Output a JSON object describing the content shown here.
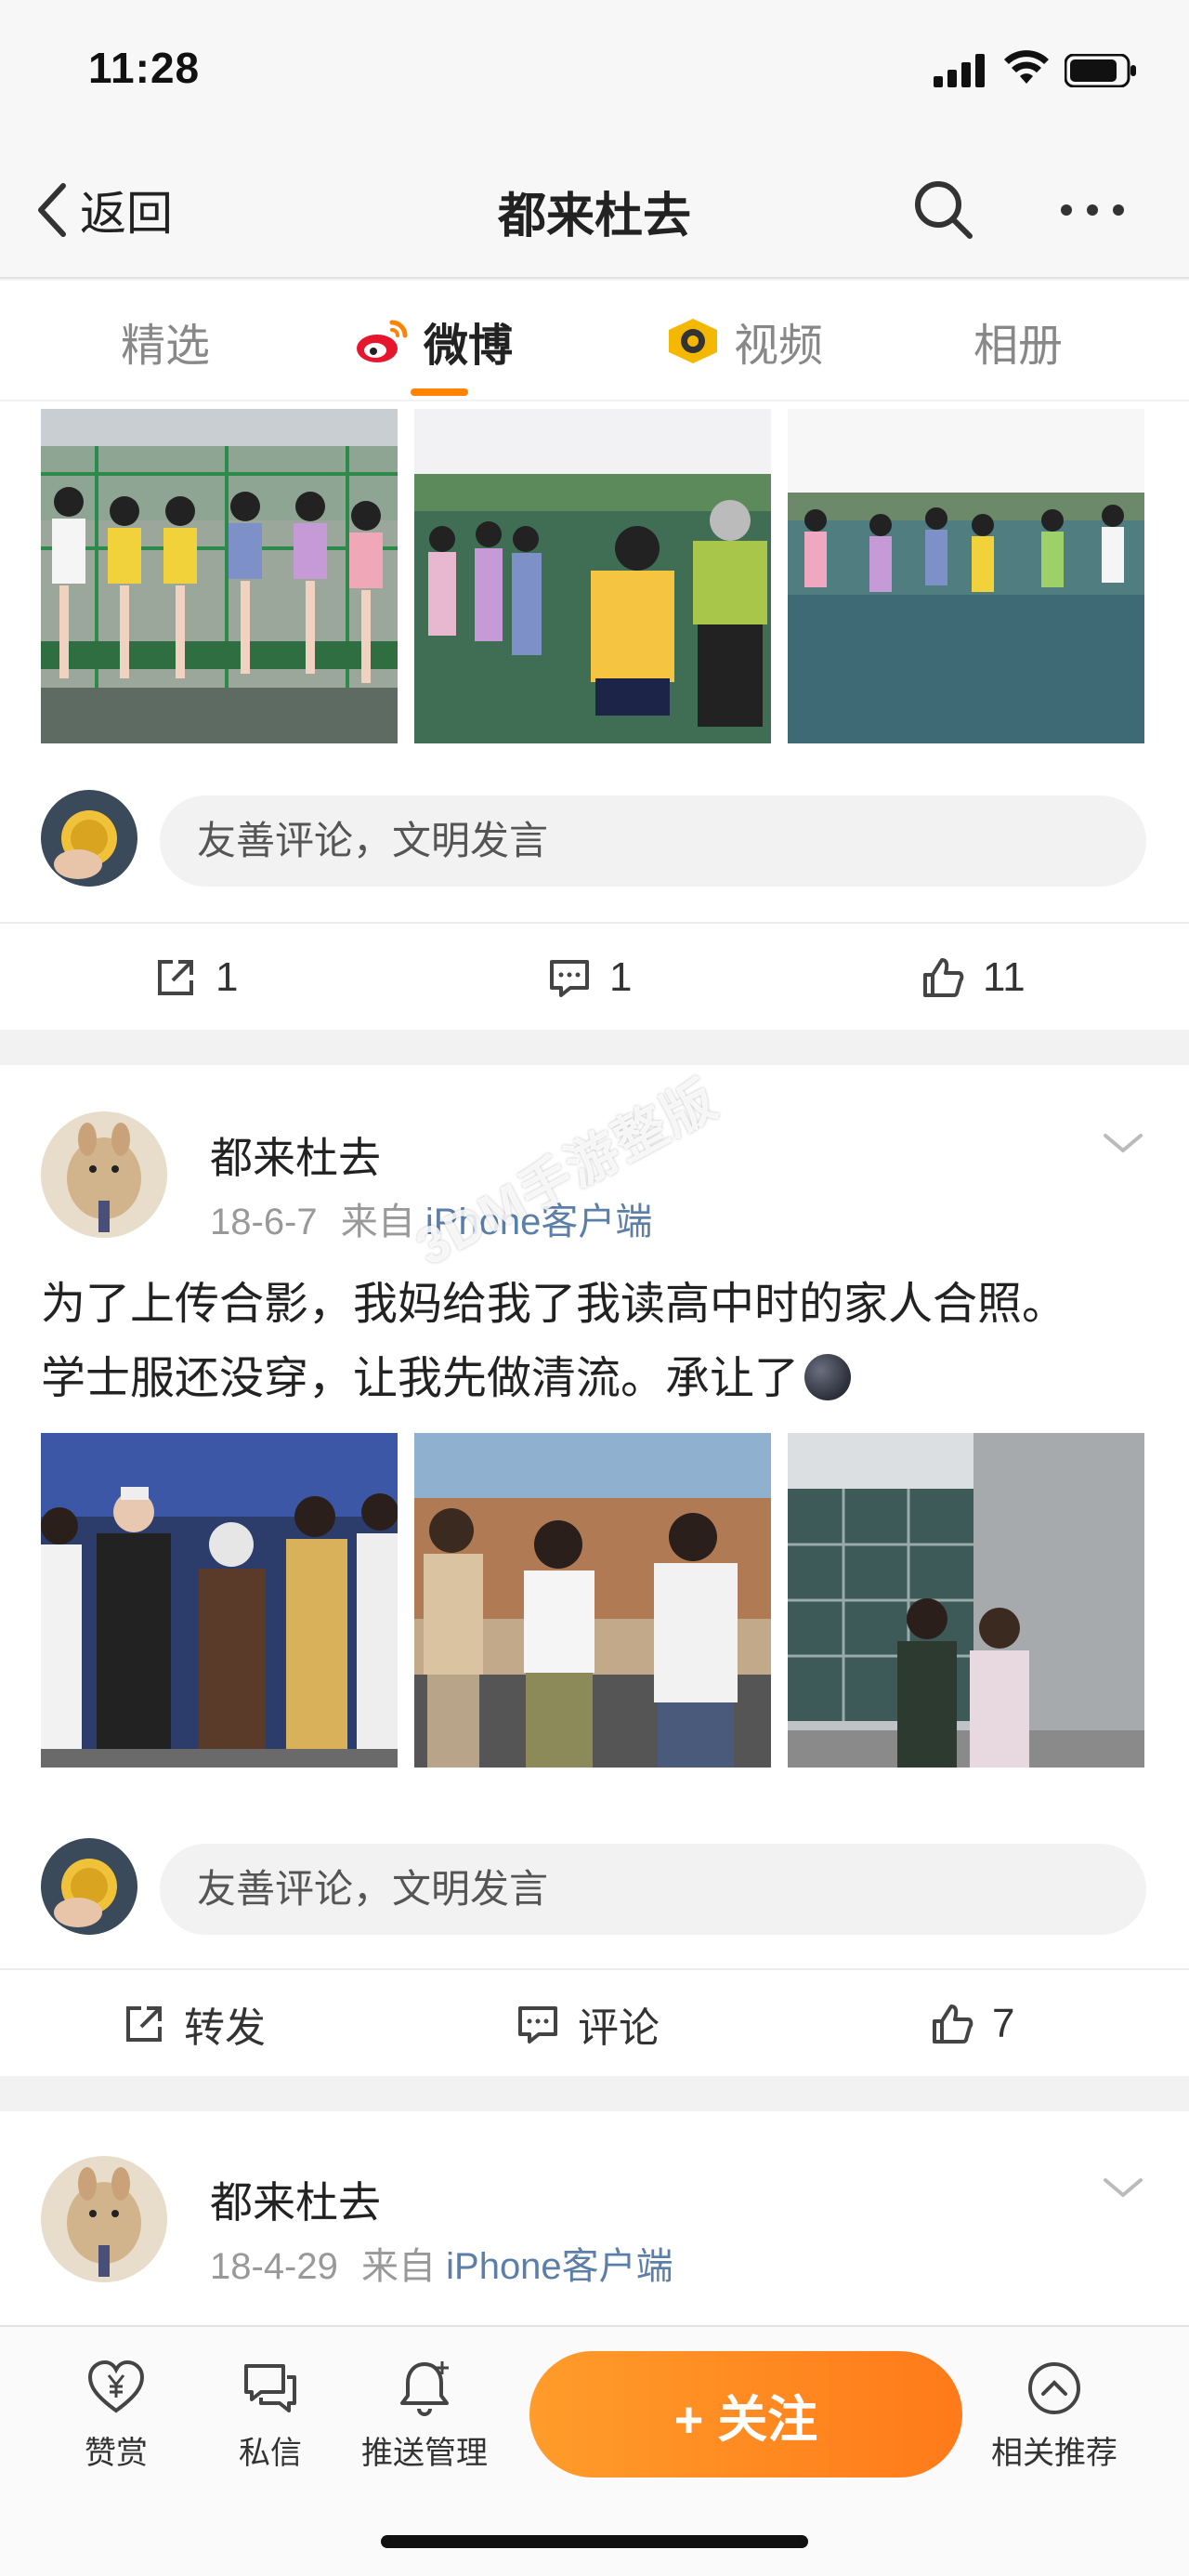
{
  "status_bar": {
    "time": "11:28"
  },
  "nav": {
    "back_label": "返回",
    "title": "都来杜去"
  },
  "tabs": [
    {
      "label": "精选"
    },
    {
      "label": "微博"
    },
    {
      "label": "视频"
    },
    {
      "label": "相册"
    }
  ],
  "post1": {
    "comment_placeholder": "友善评论，文明发言",
    "actions": {
      "repost": "1",
      "comment": "1",
      "like": "11"
    }
  },
  "post2": {
    "author": "都来杜去",
    "date": "18-6-7",
    "source_prefix": "来自",
    "source": "iPhone客户端",
    "text_line1": "为了上传合影，我妈给我了我读高中时的家人合照。",
    "text_line2": "学士服还没穿，让我先做清流。承让了",
    "comment_placeholder": "友善评论，文明发言",
    "actions": {
      "repost": "转发",
      "comment": "评论",
      "like": "7"
    }
  },
  "post3": {
    "author": "都来杜去",
    "date": "18-4-29",
    "source_prefix": "来自",
    "source": "iPhone客户端"
  },
  "watermark": "3DM手游整版",
  "bottom_bar": {
    "reward": "赞赏",
    "message": "私信",
    "push": "推送管理",
    "follow": "+ 关注",
    "related": "相关推荐"
  },
  "colors": {
    "accent": "#ff8200",
    "link": "#5b7fa8",
    "follow_start": "#ff9c2a",
    "follow_end": "#ff7a1a"
  }
}
